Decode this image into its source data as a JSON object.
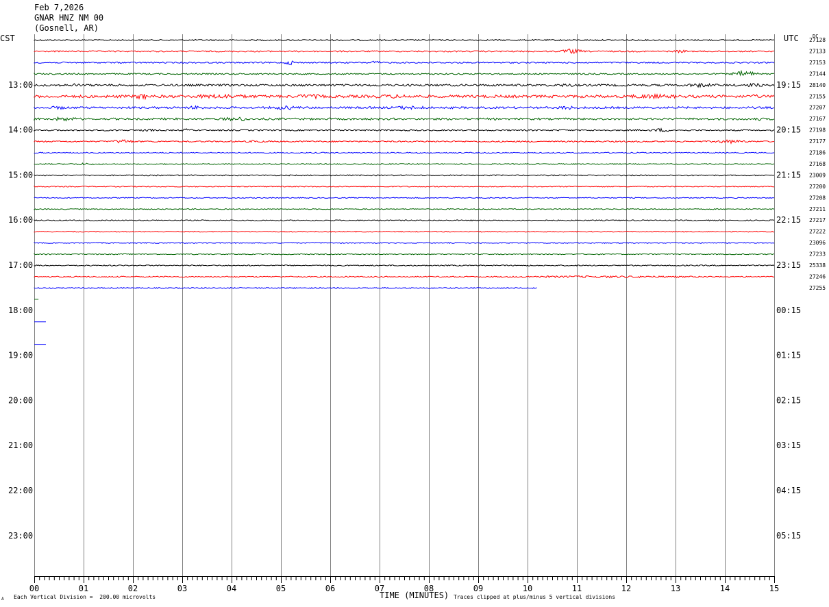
{
  "header": {
    "date": "Feb 7,2026",
    "station": "GNAR HNZ NM 00",
    "location": "(Gosnell, AR)"
  },
  "left_zone": "CST",
  "right_zone": "UTC",
  "dc_label": "DC",
  "footer": {
    "scale_note": "Each Vertical Division =  200.00 microvolts",
    "clip_note": "Traces clipped at plus/minus 5 vertical divisions",
    "corner_mark": "A"
  },
  "colors": {
    "grid": "#808080",
    "traces": [
      "#000000",
      "#ff0000",
      "#0000ff",
      "#006400"
    ]
  },
  "chart_data": {
    "type": "line",
    "title": "",
    "xlabel": "TIME (MINUTES)",
    "x_ticks": [
      "00",
      "01",
      "02",
      "03",
      "04",
      "05",
      "06",
      "07",
      "08",
      "09",
      "10",
      "11",
      "12",
      "13",
      "14",
      "15"
    ],
    "xlim": [
      0,
      15
    ],
    "row_minutes": 15,
    "total_rows": 48,
    "left_time_labels": [
      {
        "row": 4,
        "label": "13:00"
      },
      {
        "row": 8,
        "label": "14:00"
      },
      {
        "row": 12,
        "label": "15:00"
      },
      {
        "row": 16,
        "label": "16:00"
      },
      {
        "row": 20,
        "label": "17:00"
      },
      {
        "row": 24,
        "label": "18:00"
      },
      {
        "row": 28,
        "label": "19:00"
      },
      {
        "row": 32,
        "label": "20:00"
      },
      {
        "row": 36,
        "label": "21:00"
      },
      {
        "row": 40,
        "label": "22:00"
      },
      {
        "row": 44,
        "label": "23:00"
      }
    ],
    "right_time_labels": [
      {
        "row": 4,
        "label": "19:15"
      },
      {
        "row": 8,
        "label": "20:15"
      },
      {
        "row": 12,
        "label": "21:15"
      },
      {
        "row": 16,
        "label": "22:15"
      },
      {
        "row": 20,
        "label": "23:15"
      },
      {
        "row": 24,
        "label": "00:15"
      },
      {
        "row": 28,
        "label": "01:15"
      },
      {
        "row": 32,
        "label": "02:15"
      },
      {
        "row": 36,
        "label": "03:15"
      },
      {
        "row": 40,
        "label": "04:15"
      },
      {
        "row": 44,
        "label": "05:15"
      }
    ],
    "trace_rows": [
      {
        "row": 0,
        "dc": "27128",
        "end_min": 15,
        "amp": 1.0,
        "bursts": []
      },
      {
        "row": 1,
        "dc": "27133",
        "end_min": 15,
        "amp": 1.0,
        "bursts": [
          [
            10.9,
            3.5,
            0.3
          ],
          [
            13.1,
            2.0,
            0.2
          ]
        ]
      },
      {
        "row": 2,
        "dc": "27153",
        "end_min": 15,
        "amp": 1.0,
        "bursts": [
          [
            5.2,
            3.0,
            0.2
          ],
          [
            6.9,
            2.5,
            0.2
          ]
        ]
      },
      {
        "row": 3,
        "dc": "27144",
        "end_min": 15,
        "amp": 1.0,
        "bursts": [
          [
            14.4,
            4.5,
            0.35
          ]
        ]
      },
      {
        "row": 4,
        "dc": "28140",
        "end_min": 15,
        "amp": 1.5,
        "bursts": [
          [
            0.8,
            2.0,
            0.2
          ],
          [
            10.8,
            2.0,
            0.3
          ],
          [
            13.5,
            2.5,
            0.5
          ],
          [
            14.6,
            2.5,
            0.3
          ]
        ]
      },
      {
        "row": 5,
        "dc": "27155",
        "end_min": 15,
        "amp": 2.0,
        "bursts": [
          [
            2.2,
            3.5,
            0.3
          ],
          [
            3.8,
            2.5,
            1.2
          ],
          [
            5.6,
            2.5,
            0.6
          ],
          [
            7.3,
            2.0,
            1.0
          ],
          [
            12.5,
            2.5,
            1.0
          ],
          [
            14.6,
            2.0,
            0.3
          ]
        ]
      },
      {
        "row": 6,
        "dc": "27207",
        "end_min": 15,
        "amp": 1.5,
        "bursts": [
          [
            0.5,
            2.0,
            0.3
          ],
          [
            3.3,
            2.5,
            0.3
          ],
          [
            5.1,
            2.5,
            0.5
          ],
          [
            7.6,
            2.0,
            0.8
          ],
          [
            10.8,
            2.5,
            0.3
          ]
        ]
      },
      {
        "row": 7,
        "dc": "27167",
        "end_min": 15,
        "amp": 1.5,
        "bursts": [
          [
            0.6,
            2.5,
            0.5
          ],
          [
            4.1,
            2.5,
            0.5
          ],
          [
            14.7,
            1.5,
            0.2
          ]
        ]
      },
      {
        "row": 8,
        "dc": "27198",
        "end_min": 15,
        "amp": 1.0,
        "bursts": [
          [
            2.3,
            2.0,
            0.2
          ],
          [
            3.1,
            2.0,
            0.2
          ],
          [
            12.7,
            2.5,
            0.3
          ]
        ]
      },
      {
        "row": 9,
        "dc": "27177",
        "end_min": 15,
        "amp": 1.0,
        "bursts": [
          [
            1.8,
            3.0,
            0.3
          ],
          [
            4.5,
            2.0,
            0.2
          ],
          [
            14.1,
            2.5,
            0.5
          ]
        ]
      },
      {
        "row": 10,
        "dc": "27186",
        "end_min": 15,
        "amp": 0.8,
        "bursts": []
      },
      {
        "row": 11,
        "dc": "27168",
        "end_min": 15,
        "amp": 0.8,
        "bursts": [
          [
            1.0,
            1.2,
            0.5
          ]
        ]
      },
      {
        "row": 12,
        "dc": "23009",
        "end_min": 15,
        "amp": 0.8,
        "bursts": []
      },
      {
        "row": 13,
        "dc": "27200",
        "end_min": 15,
        "amp": 0.7,
        "bursts": []
      },
      {
        "row": 14,
        "dc": "27208",
        "end_min": 15,
        "amp": 0.7,
        "bursts": []
      },
      {
        "row": 15,
        "dc": "27211",
        "end_min": 15,
        "amp": 0.7,
        "bursts": []
      },
      {
        "row": 16,
        "dc": "27217",
        "end_min": 15,
        "amp": 0.8,
        "bursts": []
      },
      {
        "row": 17,
        "dc": "27222",
        "end_min": 15,
        "amp": 0.7,
        "bursts": []
      },
      {
        "row": 18,
        "dc": "23096",
        "end_min": 15,
        "amp": 0.7,
        "bursts": []
      },
      {
        "row": 19,
        "dc": "27233",
        "end_min": 15,
        "amp": 0.7,
        "bursts": []
      },
      {
        "row": 20,
        "dc": "25338",
        "end_min": 15,
        "amp": 0.8,
        "bursts": []
      },
      {
        "row": 21,
        "dc": "27246",
        "end_min": 15,
        "amp": 0.8,
        "bursts": [
          [
            11.5,
            1.2,
            3.5
          ]
        ]
      },
      {
        "row": 22,
        "dc": "27255",
        "end_min": 10.2,
        "amp": 0.8,
        "bursts": []
      }
    ],
    "stub_marks": [
      {
        "row": 23,
        "from_min": 0,
        "to_min": 0.03,
        "color_index": 3
      },
      {
        "row": 25,
        "from_min": 0,
        "to_min": 0.18,
        "color_index": 2
      },
      {
        "row": 27,
        "from_min": 0,
        "to_min": 0.18,
        "color_index": 2
      }
    ]
  }
}
